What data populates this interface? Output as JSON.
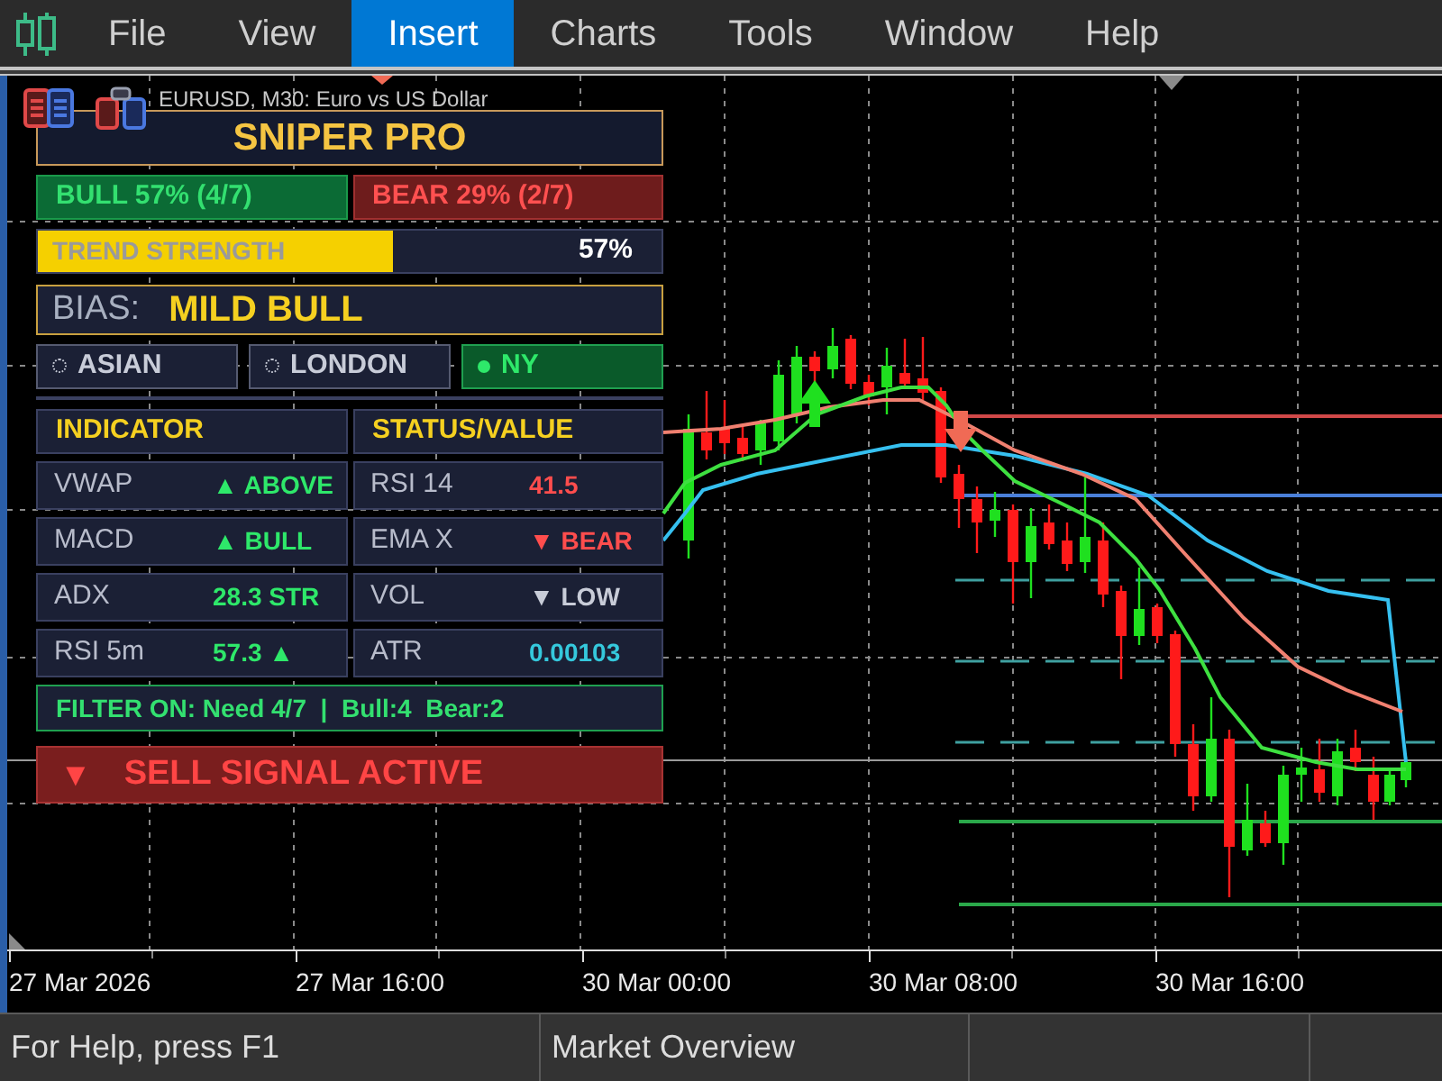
{
  "menu": [
    {
      "label": "File",
      "selected": false
    },
    {
      "label": "View",
      "selected": false
    },
    {
      "label": "Insert",
      "selected": true
    },
    {
      "label": "Charts",
      "selected": false
    },
    {
      "label": "Tools",
      "selected": false
    },
    {
      "label": "Window",
      "selected": false
    },
    {
      "label": "Help",
      "selected": false
    }
  ],
  "chart": {
    "title": "EURUSD, M30: Euro vs US Dollar",
    "time_labels": [
      "27 Mar 2026",
      "27 Mar 16:00",
      "30 Mar 00:00",
      "30 Mar 08:00",
      "30 Mar 16:00"
    ]
  },
  "panel": {
    "title": "SNIPER PRO",
    "votes": [
      {
        "kind": "bull",
        "text": "BULL 57% (4/7)"
      },
      {
        "kind": "bear",
        "text": "BEAR 29% (2/7)"
      }
    ],
    "trend_strength": {
      "label": "TREND STRENGTH",
      "level": 0.57,
      "reading": "57%"
    },
    "bias": {
      "label": "BIAS:",
      "value": "MILD BULL"
    },
    "sessions": [
      {
        "label": "ASIAN",
        "active": false
      },
      {
        "label": "LONDON",
        "active": false
      },
      {
        "label": "NY",
        "active": true
      }
    ],
    "indicators": {
      "columns": [
        "INDICATOR",
        "STATUS/VALUE"
      ],
      "rows": [
        [
          {
            "name": "VWAP",
            "value": "▲ ABOVE",
            "color": "#2ee86a"
          },
          {
            "name": "RSI 14",
            "value": "41.5",
            "color": "#ff4d4d"
          }
        ],
        [
          {
            "name": "MACD",
            "value": "▲ BULL",
            "color": "#2ee86a"
          },
          {
            "name": "EMA X",
            "value": "▼ BEAR",
            "color": "#ff4d4d"
          }
        ],
        [
          {
            "name": "ADX",
            "value": "28.3 STR",
            "color": "#2ee86a"
          },
          {
            "name": "VOL",
            "value": "▼ LOW",
            "color": "#c8ccd8"
          }
        ],
        [
          {
            "name": "RSI 5m",
            "value": "57.3 ▲",
            "color": "#2ee86a"
          },
          {
            "name": "ATR",
            "value": "0.00103",
            "color": "#35c8dc"
          }
        ]
      ]
    },
    "filter": "FILTER ON: Need 4/7  |  Bull:4  Bear:2",
    "signal": {
      "kind": "sell",
      "icon": "▼",
      "text": "SELL SIGNAL ACTIVE"
    }
  },
  "status_bar": [
    "For Help, press F1",
    "Market Overview"
  ]
}
